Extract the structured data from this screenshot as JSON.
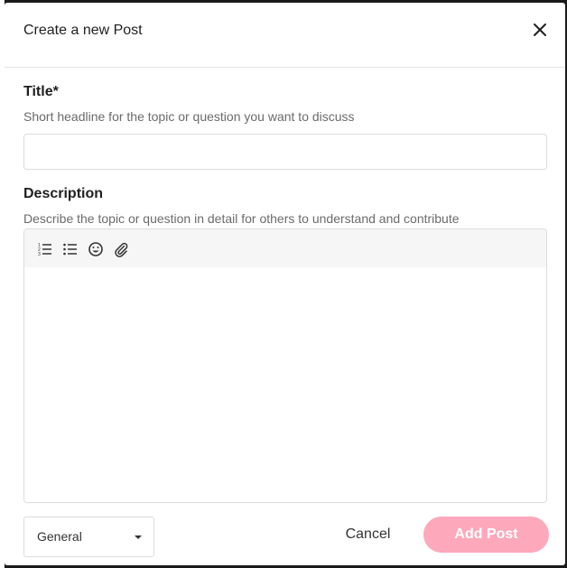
{
  "modal": {
    "title": "Create a new Post"
  },
  "title_field": {
    "label": "Title*",
    "help": "Short headline for the topic or question you want to discuss",
    "value": "",
    "placeholder": ""
  },
  "description_field": {
    "label": "Description",
    "help": "Describe the topic or question in detail for others to understand and contribute",
    "toolbar": [
      "ordered-list-icon",
      "bulleted-list-icon",
      "emoji-icon",
      "attachment-icon"
    ]
  },
  "footer": {
    "category": "General",
    "cancel_label": "Cancel",
    "submit_label": "Add Post"
  },
  "colors": {
    "accent": "#fda8bb"
  }
}
